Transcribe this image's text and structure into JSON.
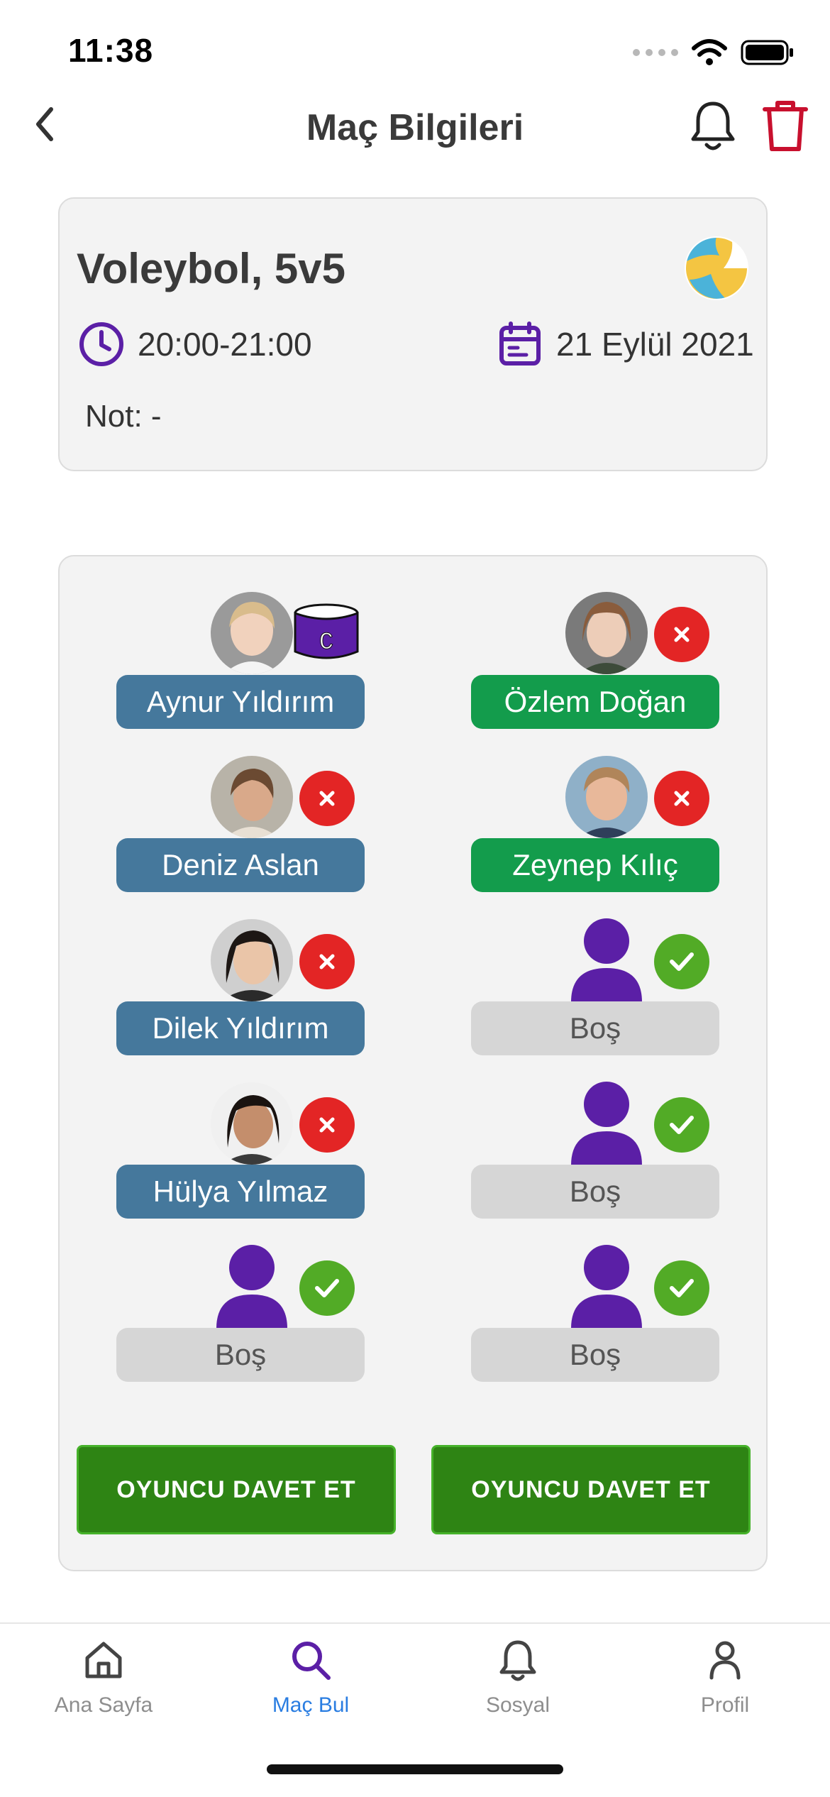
{
  "status_bar": {
    "time": "11:38"
  },
  "header": {
    "title": "Maç Bilgileri"
  },
  "match": {
    "sport": "Voleybol, 5v5",
    "time_range": "20:00-21:00",
    "date": "21 Eylül 2021",
    "note": "Not: -"
  },
  "teams": {
    "left": [
      {
        "name": "Aynur Yıldırım",
        "captain": true,
        "captain_letter": "C"
      },
      {
        "name": "Deniz Aslan"
      },
      {
        "name": "Dilek Yıldırım"
      },
      {
        "name": "Hülya Yılmaz"
      },
      {
        "name": "Boş",
        "empty": true
      }
    ],
    "right": [
      {
        "name": "Özlem Doğan"
      },
      {
        "name": "Zeynep Kılıç"
      },
      {
        "name": "Boş",
        "empty": true
      },
      {
        "name": "Boş",
        "empty": true
      },
      {
        "name": "Boş",
        "empty": true
      }
    ],
    "invite_left_label": "OYUNCU DAVET ET",
    "invite_right_label": "OYUNCU DAVET ET"
  },
  "bottom_nav": {
    "items": [
      {
        "label": "Ana Sayfa",
        "icon": "home-icon",
        "active": false
      },
      {
        "label": "Maç Bul",
        "icon": "search-icon",
        "active": true
      },
      {
        "label": "Sosyal",
        "icon": "bell-icon",
        "active": false
      },
      {
        "label": "Profil",
        "icon": "person-icon",
        "active": false
      }
    ]
  },
  "colors": {
    "accent_purple": "#5b1fa6",
    "left_team": "#45789c",
    "right_team": "#139c4c",
    "invite_button": "#2e8414",
    "delete_red": "#c8102e",
    "nav_active": "#2a7de1"
  }
}
